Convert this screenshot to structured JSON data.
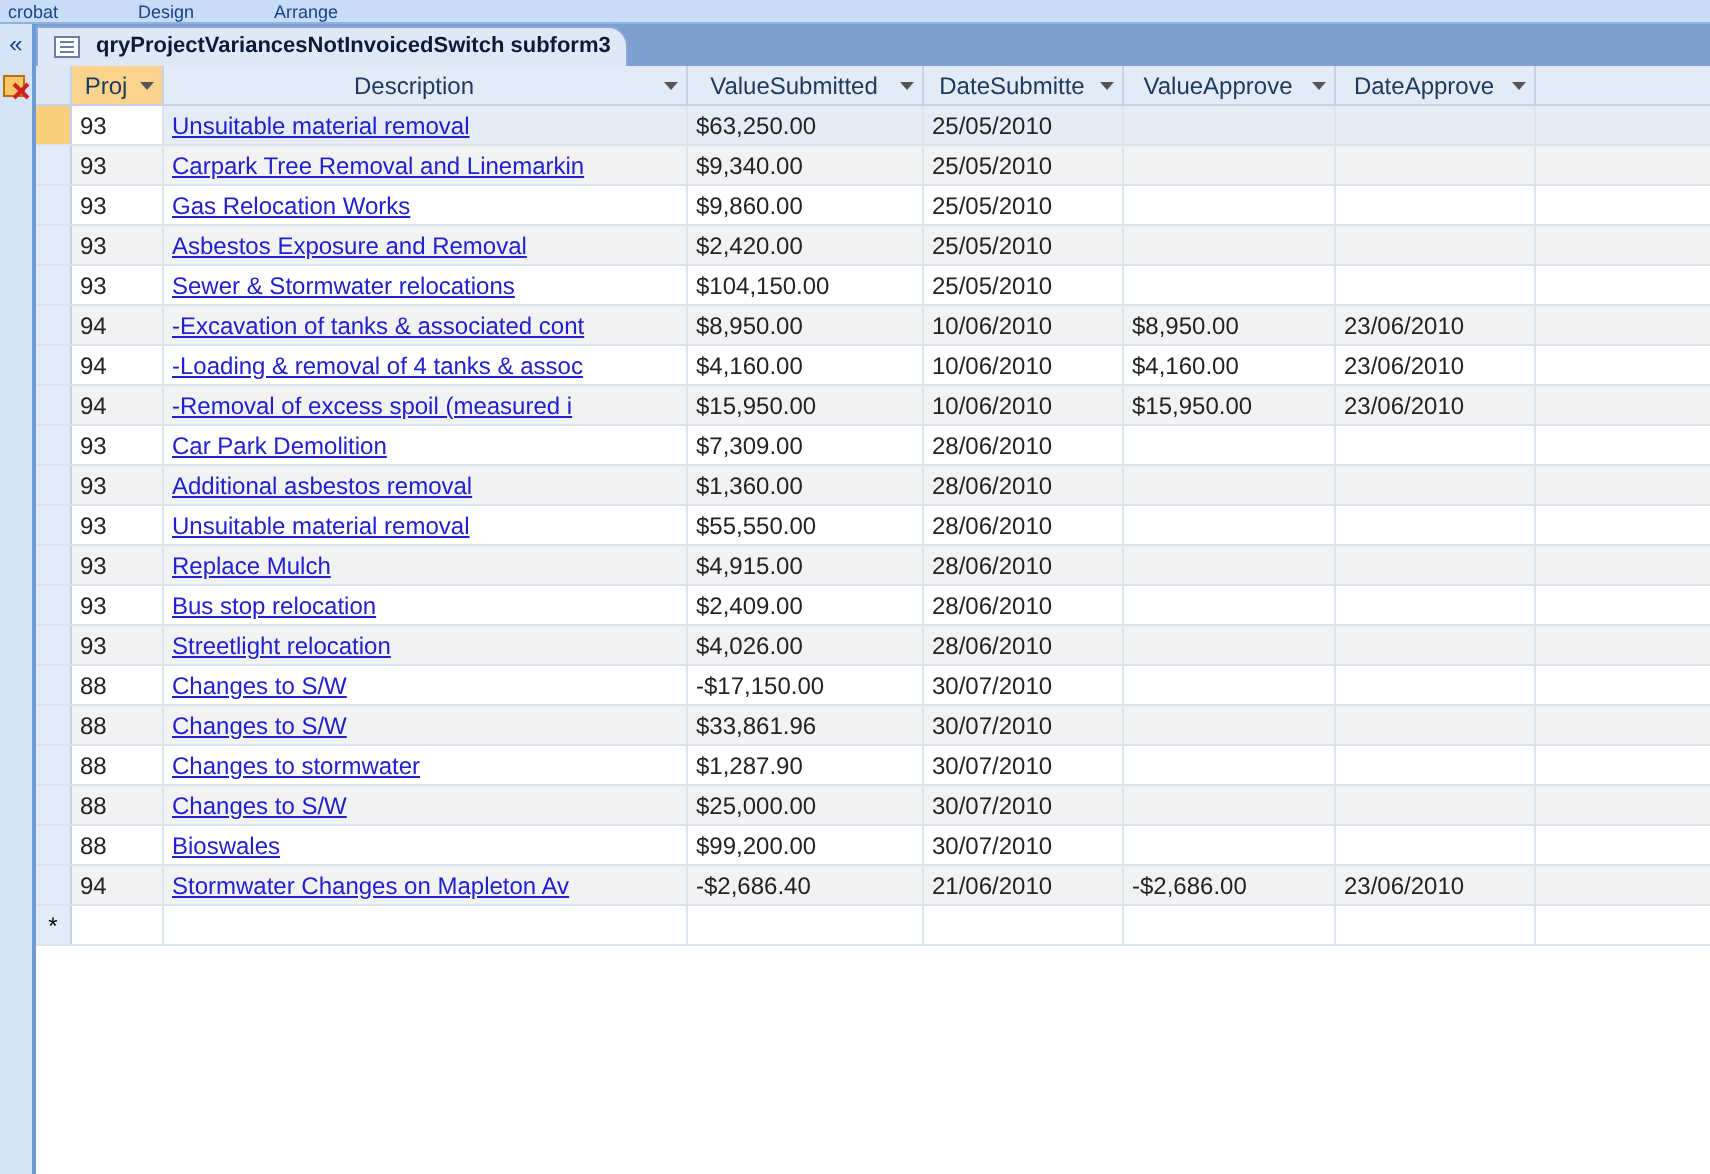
{
  "ribbon_tabs": [
    {
      "label": "crobat"
    },
    {
      "label": "Design"
    },
    {
      "label": "Arrange"
    }
  ],
  "nav_pane": {
    "collapse": "«"
  },
  "document_tab": {
    "title": "qryProjectVariancesNotInvoicedSwitch subform3"
  },
  "columns": [
    {
      "label": "Proj",
      "selected": true
    },
    {
      "label": "Description",
      "selected": false
    },
    {
      "label": "ValueSubmitted",
      "selected": false
    },
    {
      "label": "DateSubmitte",
      "selected": false
    },
    {
      "label": "ValueApprove",
      "selected": false
    },
    {
      "label": "DateApprove",
      "selected": false
    }
  ],
  "rows": [
    {
      "selected": true,
      "proj": "93",
      "description": "Unsuitable material removal",
      "value_submitted": "$63,250.00",
      "date_submitted": "25/05/2010"
    },
    {
      "selected": false,
      "proj": "93",
      "description": "Carpark Tree Removal and Linemarkin",
      "value_submitted": "$9,340.00",
      "date_submitted": "25/05/2010"
    },
    {
      "selected": false,
      "proj": "93",
      "description": "Gas Relocation Works",
      "value_submitted": "$9,860.00",
      "date_submitted": "25/05/2010"
    },
    {
      "selected": false,
      "proj": "93",
      "description": "Asbestos Exposure and Removal",
      "value_submitted": "$2,420.00",
      "date_submitted": "25/05/2010"
    },
    {
      "selected": false,
      "proj": "93",
      "description": "Sewer & Stormwater relocations",
      "value_submitted": "$104,150.00",
      "date_submitted": "25/05/2010"
    },
    {
      "selected": false,
      "proj": "94",
      "description": "-Excavation of tanks & associated cont",
      "value_submitted": "$8,950.00",
      "date_submitted": "10/06/2010",
      "value_approved": "$8,950.00",
      "date_approved": "23/06/2010"
    },
    {
      "selected": false,
      "proj": "94",
      "description": "-Loading & removal of 4 tanks & assoc",
      "value_submitted": "$4,160.00",
      "date_submitted": "10/06/2010",
      "value_approved": "$4,160.00",
      "date_approved": "23/06/2010"
    },
    {
      "selected": false,
      "proj": "94",
      "description": "-Removal of excess spoil (measured i",
      "value_submitted": "$15,950.00",
      "date_submitted": "10/06/2010",
      "value_approved": "$15,950.00",
      "date_approved": "23/06/2010"
    },
    {
      "selected": false,
      "proj": "93",
      "description": "Car Park Demolition",
      "value_submitted": "$7,309.00",
      "date_submitted": "28/06/2010"
    },
    {
      "selected": false,
      "proj": "93",
      "description": "Additional asbestos removal",
      "value_submitted": "$1,360.00",
      "date_submitted": "28/06/2010"
    },
    {
      "selected": false,
      "proj": "93",
      "description": "Unsuitable material removal",
      "value_submitted": "$55,550.00",
      "date_submitted": "28/06/2010"
    },
    {
      "selected": false,
      "proj": "93",
      "description": "Replace Mulch",
      "value_submitted": "$4,915.00",
      "date_submitted": "28/06/2010"
    },
    {
      "selected": false,
      "proj": "93",
      "description": "Bus stop relocation",
      "value_submitted": "$2,409.00",
      "date_submitted": "28/06/2010"
    },
    {
      "selected": false,
      "proj": "93",
      "description": "Streetlight relocation",
      "value_submitted": "$4,026.00",
      "date_submitted": "28/06/2010"
    },
    {
      "selected": false,
      "proj": "88",
      "description": "Changes to S/W",
      "value_submitted": "-$17,150.00",
      "date_submitted": "30/07/2010"
    },
    {
      "selected": false,
      "proj": "88",
      "description": "Changes to S/W",
      "value_submitted": "$33,861.96",
      "date_submitted": "30/07/2010"
    },
    {
      "selected": false,
      "proj": "88",
      "description": "Changes to stormwater",
      "value_submitted": "$1,287.90",
      "date_submitted": "30/07/2010"
    },
    {
      "selected": false,
      "proj": "88",
      "description": "Changes to S/W",
      "value_submitted": "$25,000.00",
      "date_submitted": "30/07/2010"
    },
    {
      "selected": false,
      "proj": "88",
      "description": "Bioswales",
      "value_submitted": "$99,200.00",
      "date_submitted": "30/07/2010"
    },
    {
      "selected": false,
      "proj": "94",
      "description": "Stormwater Changes on Mapleton Av",
      "value_submitted": "-$2,686.40",
      "date_submitted": "21/06/2010",
      "value_approved": "-$2,686.00",
      "date_approved": "23/06/2010"
    }
  ],
  "new_row": {
    "marker": "*"
  }
}
